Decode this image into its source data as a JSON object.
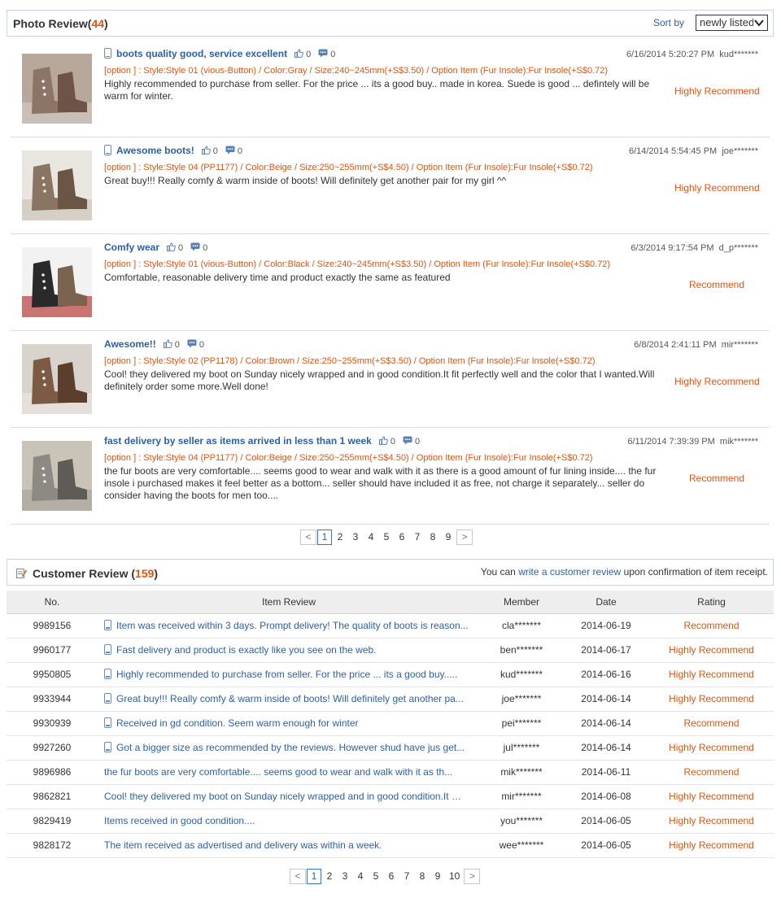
{
  "photo_review": {
    "title": "Photo Review(",
    "count": "44",
    "title_close": ")",
    "sort_label": "Sort by",
    "sort_value": "newly listed",
    "items": [
      {
        "title": "boots quality good, service excellent",
        "likes": "0",
        "comments": "0",
        "date": "6/16/2014 5:20:27 PM",
        "user": "kud*******",
        "option": "[option ] : Style:Style 01 (vious-Button) / Color:Gray / Size:240~245mm(+S$3.50) / Option Item (Fur Insole):Fur Insole(+S$0.72)",
        "body": "Highly recommended to purchase from seller. For the price ... its a good buy.. made in korea. Suede is good ... defintely will be warm for winter.",
        "rating": "Highly Recommend",
        "mobile": true
      },
      {
        "title": "Awesome boots!",
        "likes": "0",
        "comments": "0",
        "date": "6/14/2014 5:54:45 PM",
        "user": "joe*******",
        "option": "[option ] : Style:Style 04 (PP1177) / Color:Beige / Size:250~255mm(+S$4.50) / Option Item (Fur Insole):Fur Insole(+S$0.72)",
        "body": "Great buy!!! Really comfy & warm inside of boots! Will definitely get another pair for my girl ^^",
        "rating": "Highly Recommend",
        "mobile": true
      },
      {
        "title": "Comfy wear",
        "likes": "0",
        "comments": "0",
        "date": "6/3/2014 9:17:54 PM",
        "user": "d_p*******",
        "option": "[option ] : Style:Style 01 (vious-Button) / Color:Black / Size:240~245mm(+S$3.50) / Option Item (Fur Insole):Fur Insole(+S$0.72)",
        "body": "Comfortable, reasonable delivery time and product exactly the same as featured",
        "rating": "Recommend",
        "mobile": false
      },
      {
        "title": "Awesome!!",
        "likes": "0",
        "comments": "0",
        "date": "6/8/2014 2:41:11 PM",
        "user": "mir*******",
        "option": "[option ] : Style:Style 02 (PP1178) / Color:Brown / Size:250~255mm(+S$3.50) / Option Item (Fur Insole):Fur Insole(+S$0.72)",
        "body": "Cool! they delivered my boot on Sunday nicely wrapped and in good condition.It fit perfectly well and the color that I wanted.Will definitely order some more.Well done!",
        "rating": "Highly Recommend",
        "mobile": false
      },
      {
        "title": "fast delivery by seller as items arrived in less than 1 week",
        "likes": "0",
        "comments": "0",
        "date": "6/11/2014 7:39:39 PM",
        "user": "mik*******",
        "option": "[option ] : Style:Style 04 (PP1177) / Color:Beige / Size:250~255mm(+S$4.50) / Option Item (Fur Insole):Fur Insole(+S$0.72)",
        "body": "the fur boots are very comfortable.... seems good to wear and walk with it as there is a good amount of fur lining inside.... the fur insole i purchased makes it feel better as a bottom... seller should have included it as free, not charge it separately... seller do consider having the boots for men too....",
        "rating": "Recommend",
        "mobile": false
      }
    ],
    "pager": {
      "prev": "<",
      "next": ">",
      "pages": [
        "1",
        "2",
        "3",
        "4",
        "5",
        "6",
        "7",
        "8",
        "9"
      ]
    }
  },
  "customer_review": {
    "title": "Customer Review (",
    "count": "159",
    "title_close": ")",
    "note_prefix": "You can ",
    "note_link": "write a customer review",
    "note_suffix": " upon confirmation of item receipt.",
    "columns": [
      "No.",
      "Item Review",
      "Member",
      "Date",
      "Rating"
    ],
    "rows": [
      {
        "no": "9989156",
        "review": "Item was received within 3 days. Prompt delivery! The quality of boots is reason...",
        "member": "cla*******",
        "date": "2014-06-19",
        "rating": "Recommend",
        "mobile": true
      },
      {
        "no": "9960177",
        "review": "Fast delivery and product is exactly like you see on the web.",
        "member": "ben*******",
        "date": "2014-06-17",
        "rating": "Highly Recommend",
        "mobile": true
      },
      {
        "no": "9950805",
        "review": "Highly recommended to purchase from seller. For the price ... its a good buy.....",
        "member": "kud*******",
        "date": "2014-06-16",
        "rating": "Highly Recommend",
        "mobile": true
      },
      {
        "no": "9933944",
        "review": "Great buy!!! Really comfy & warm inside of boots! Will definitely get another pa...",
        "member": "joe*******",
        "date": "2014-06-14",
        "rating": "Highly Recommend",
        "mobile": true
      },
      {
        "no": "9930939",
        "review": "Received in gd condition. Seem warm enough for winter",
        "member": "pei*******",
        "date": "2014-06-14",
        "rating": "Recommend",
        "mobile": true
      },
      {
        "no": "9927260",
        "review": "Got a bigger size as recommended by the reviews. However shud have jus get...",
        "member": "jul*******",
        "date": "2014-06-14",
        "rating": "Highly Recommend",
        "mobile": true
      },
      {
        "no": "9896986",
        "review": "the fur boots are very comfortable.... seems good to wear and walk with it as th...",
        "member": "mik*******",
        "date": "2014-06-11",
        "rating": "Recommend",
        "mobile": false
      },
      {
        "no": "9862821",
        "review": "Cool! they delivered my boot on Sunday nicely wrapped and in good condition.It f...",
        "member": "mir*******",
        "date": "2014-06-08",
        "rating": "Highly Recommend",
        "mobile": false
      },
      {
        "no": "9829419",
        "review": "Items received in good condition....",
        "member": "you*******",
        "date": "2014-06-05",
        "rating": "Highly Recommend",
        "mobile": false
      },
      {
        "no": "9828172",
        "review": "The item received as advertised and delivery was within a week.",
        "member": "wee*******",
        "date": "2014-06-05",
        "rating": "Highly Recommend",
        "mobile": false
      }
    ],
    "pager": {
      "prev": "<",
      "next": ">",
      "pages": [
        "1",
        "2",
        "3",
        "4",
        "5",
        "6",
        "7",
        "8",
        "9",
        "10"
      ]
    }
  },
  "colors": {
    "accent": "#e5530e",
    "link": "#2b5fa8",
    "border": "#c8d4e4"
  }
}
